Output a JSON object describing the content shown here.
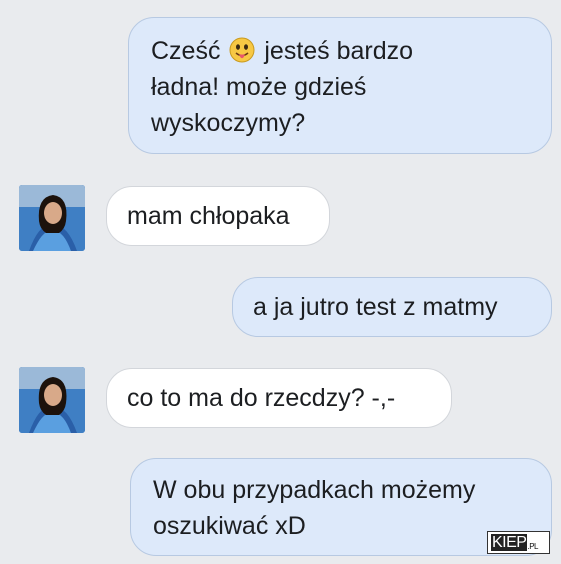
{
  "messages": [
    {
      "side": "out",
      "parts": [
        "Cześć",
        "jesteś bardzo",
        "ładna! może gdzieś",
        "wyskoczymy?"
      ],
      "emoji": "drooling-face"
    },
    {
      "side": "in",
      "text": "mam chłopaka"
    },
    {
      "side": "out",
      "text": "a ja jutro test z matmy"
    },
    {
      "side": "in",
      "text": "co to ma do rzecdzy? -,-"
    },
    {
      "side": "out",
      "lines": [
        "W obu przypadkach możemy",
        "oszukiwać xD"
      ]
    }
  ],
  "watermark": {
    "logo": "KIEP",
    "suffix": ".PL"
  },
  "colors": {
    "background": "#e9ebee",
    "outgoing": "#dde9fa",
    "incoming": "#ffffff"
  }
}
